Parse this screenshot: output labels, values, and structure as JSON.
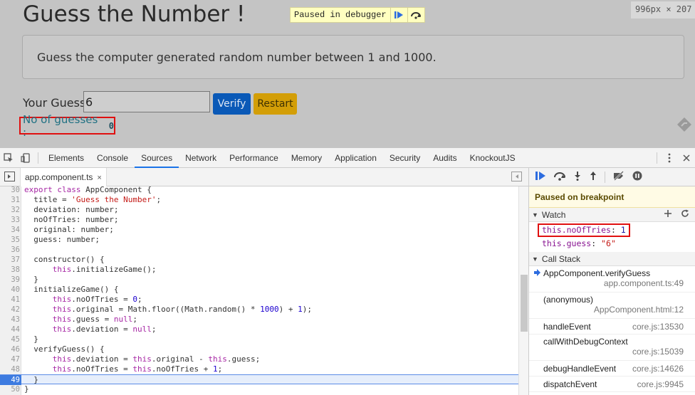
{
  "page": {
    "title": "Guess the Number !",
    "paused_badge": "Paused in debugger",
    "size_indicator": "996px × 207",
    "info_text": "Guess the computer generated random number between 1 and 1000.",
    "guess_label": "Your Guess:",
    "guess_value": "6",
    "verify_label": "Verify",
    "restart_label": "Restart",
    "guesses_label": "No of guesses :",
    "guesses_count": "0"
  },
  "devtools": {
    "tabs": [
      "Elements",
      "Console",
      "Sources",
      "Network",
      "Performance",
      "Memory",
      "Application",
      "Security",
      "Audits",
      "KnockoutJS"
    ],
    "active_tab": "Sources",
    "file_tab": "app.component.ts",
    "file_close": "×",
    "code_lines": [
      {
        "n": "30",
        "html": "<span class='kw'>export class</span> AppComponent {"
      },
      {
        "n": "31",
        "html": "  title = <span class='str'>'Guess the Number'</span>;"
      },
      {
        "n": "32",
        "html": "  deviation: number;"
      },
      {
        "n": "33",
        "html": "  noOfTries: number;"
      },
      {
        "n": "34",
        "html": "  original: number;"
      },
      {
        "n": "35",
        "html": "  guess: number;"
      },
      {
        "n": "36",
        "html": ""
      },
      {
        "n": "37",
        "html": "  constructor() {"
      },
      {
        "n": "38",
        "html": "      <span class='thisk'>this</span>.initializeGame();"
      },
      {
        "n": "39",
        "html": "  }"
      },
      {
        "n": "40",
        "html": "  initializeGame() {"
      },
      {
        "n": "41",
        "html": "      <span class='thisk'>this</span>.noOfTries = <span class='num'>0</span>;"
      },
      {
        "n": "42",
        "html": "      <span class='thisk'>this</span>.original = Math.floor((Math.random() * <span class='num'>1000</span>) + <span class='num'>1</span>);"
      },
      {
        "n": "43",
        "html": "      <span class='thisk'>this</span>.guess = <span class='kw'>null</span>;"
      },
      {
        "n": "44",
        "html": "      <span class='thisk'>this</span>.deviation = <span class='kw'>null</span>;"
      },
      {
        "n": "45",
        "html": "  }"
      },
      {
        "n": "46",
        "html": "  verifyGuess() {"
      },
      {
        "n": "47",
        "html": "      <span class='thisk'>this</span>.deviation = <span class='thisk'>this</span>.original - <span class='thisk'>this</span>.guess;"
      },
      {
        "n": "48",
        "html": "      <span class='thisk'>this</span>.noOfTries = <span class='thisk'>this</span>.noOfTries + <span class='num'>1</span>;"
      },
      {
        "n": "49",
        "html": "  }",
        "exec": true
      },
      {
        "n": "50",
        "html": "}"
      }
    ],
    "paused_status": "Paused on breakpoint",
    "watch_title": "Watch",
    "watch_items": [
      {
        "key": "this.noOfTries",
        "value": "1",
        "type": "num",
        "highlight": true
      },
      {
        "key": "this.guess",
        "value": "\"6\"",
        "type": "str",
        "highlight": false
      }
    ],
    "callstack_title": "Call Stack",
    "callstack": [
      {
        "name": "AppComponent.verifyGuess",
        "loc": "app.component.ts:49",
        "current": true,
        "twoline": true
      },
      {
        "name": "(anonymous)",
        "loc": "AppComponent.html:12",
        "current": false,
        "twoline": true
      },
      {
        "name": "handleEvent",
        "loc": "core.js:13530",
        "current": false,
        "twoline": false
      },
      {
        "name": "callWithDebugContext",
        "loc": "core.js:15039",
        "current": false,
        "twoline": true
      },
      {
        "name": "debugHandleEvent",
        "loc": "core.js:14626",
        "current": false,
        "twoline": false
      },
      {
        "name": "dispatchEvent",
        "loc": "core.js:9945",
        "current": false,
        "twoline": false
      }
    ]
  }
}
